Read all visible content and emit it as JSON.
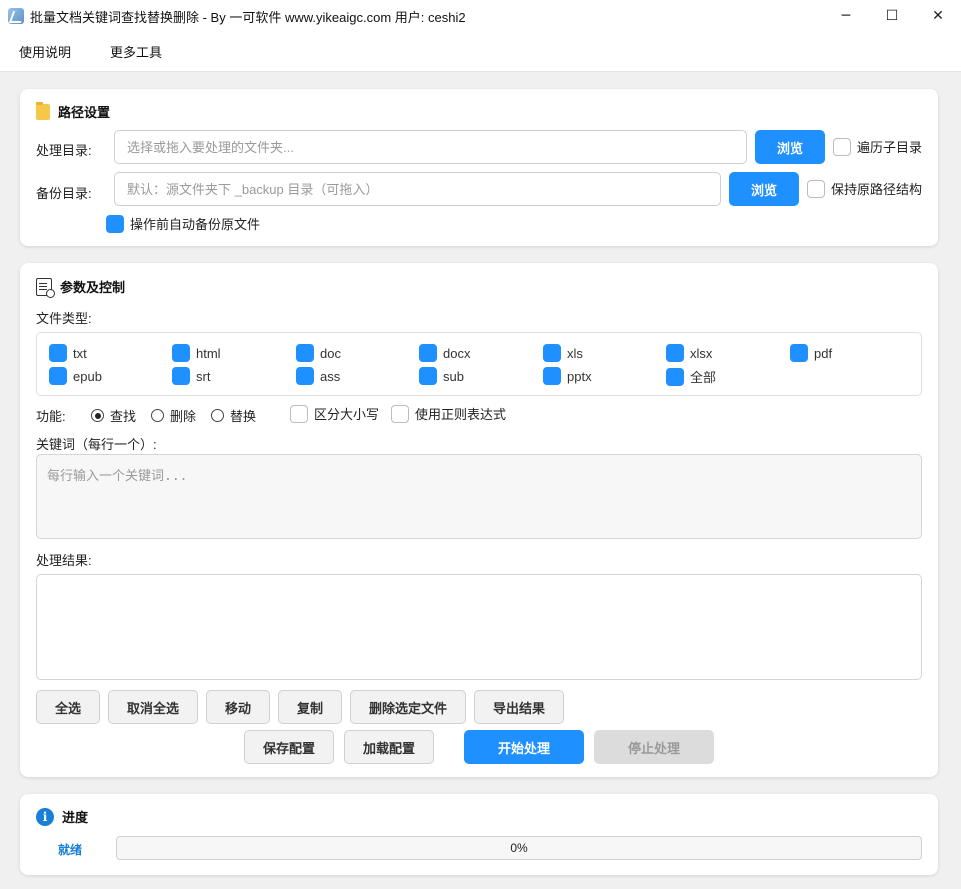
{
  "window": {
    "title": "批量文档关键词查找替换删除 - By 一可软件 www.yikeaigc.com 用户: ceshi2",
    "minimize": "─",
    "maximize": "☐",
    "close": "✕"
  },
  "menu": [
    "使用说明",
    "更多工具"
  ],
  "path": {
    "title": "路径设置",
    "process_label": "处理目录:",
    "process_placeholder": "选择或拖入要处理的文件夹...",
    "process_value": "",
    "browse_label": "浏览",
    "recursive_label": "遍历子目录",
    "recursive_checked": false,
    "backup_label": "备份目录:",
    "backup_placeholder": "默认：源文件夹下 _backup 目录（可拖入）",
    "backup_value": "",
    "keep_structure_label": "保持原路径结构",
    "keep_structure_checked": false,
    "auto_backup_label": "操作前自动备份原文件",
    "auto_backup_checked": true
  },
  "params": {
    "title": "参数及控制",
    "file_types_label": "文件类型:",
    "file_types": [
      {
        "label": "txt",
        "checked": true
      },
      {
        "label": "html",
        "checked": true
      },
      {
        "label": "doc",
        "checked": true
      },
      {
        "label": "docx",
        "checked": true
      },
      {
        "label": "xls",
        "checked": true
      },
      {
        "label": "xlsx",
        "checked": true
      },
      {
        "label": "pdf",
        "checked": true
      },
      {
        "label": "epub",
        "checked": true
      },
      {
        "label": "srt",
        "checked": true
      },
      {
        "label": "ass",
        "checked": true
      },
      {
        "label": "sub",
        "checked": true
      },
      {
        "label": "pptx",
        "checked": true
      },
      {
        "label": "全部",
        "checked": true
      }
    ],
    "function_label": "功能:",
    "functions": [
      {
        "label": "查找",
        "selected": true
      },
      {
        "label": "删除",
        "selected": false
      },
      {
        "label": "替换",
        "selected": false
      }
    ],
    "case_label": "区分大小写",
    "case_checked": false,
    "regex_label": "使用正则表达式",
    "regex_checked": false,
    "keywords_label": "关键词（每行一个）:",
    "keywords_placeholder": "每行输入一个关键词...",
    "results_label": "处理结果:",
    "action_buttons": [
      "全选",
      "取消全选",
      "移动",
      "复制",
      "删除选定文件",
      "导出结果"
    ],
    "save_config": "保存配置",
    "load_config": "加载配置",
    "start": "开始处理",
    "stop": "停止处理"
  },
  "progress": {
    "title": "进度",
    "status": "就绪",
    "percent": 0,
    "percent_text": "0%"
  },
  "colors": {
    "accent": "#1e90ff",
    "status": "#1a7fd6"
  }
}
